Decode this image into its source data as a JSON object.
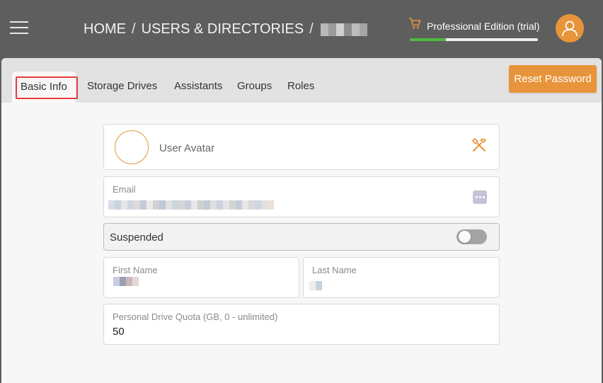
{
  "header": {
    "breadcrumb": [
      "HOME",
      "USERS & DIRECTORIES"
    ],
    "separator": "/",
    "current_user_pixels": [
      "#b9b9b9",
      "#9a9a9a",
      "#cfcfcf",
      "#8e8e8e",
      "#bcbcbc",
      "#a6a6a6"
    ],
    "edition_label": "Professional Edition (trial)",
    "trial_progress": 0.28,
    "cart_icon": "cart-icon",
    "account_icon": "user-icon"
  },
  "tabs": [
    {
      "label": "Basic Info",
      "active": true
    },
    {
      "label": "Storage Drives",
      "active": false
    },
    {
      "label": "Assistants",
      "active": false
    },
    {
      "label": "Groups",
      "active": false
    },
    {
      "label": "Roles",
      "active": false
    }
  ],
  "reset_password_label": "Reset Password",
  "form": {
    "avatar_label": "User Avatar",
    "avatar_icon": "tools-icon",
    "email_label": "Email",
    "email_pixels": [
      "#d8dde6",
      "#c9d3e1",
      "#e5e5e5",
      "#cfd7e3",
      "#dcdcdc",
      "#c4cbd8",
      "#eaeaea",
      "#d2d2d2",
      "#bfc8d6",
      "#e1e1e1",
      "#cdd5df",
      "#d6d6d6",
      "#c8cfda",
      "#e8e8e8",
      "#d0d0d0",
      "#c2cad6",
      "#dfdfdf",
      "#cbd3de",
      "#e3e3e3",
      "#d4d4d4",
      "#c6cdd9",
      "#e6e6e6",
      "#d9d9d9",
      "#cfd6e0",
      "#e0e0e0",
      "#eedfd5"
    ],
    "email_menu_icon": "more-dots-icon",
    "suspended_label": "Suspended",
    "suspended": false,
    "first_name_label": "First Name",
    "first_name_pixels": [
      "#c8cde0",
      "#9c9fb0",
      "#c9b8b8",
      "#e6d6d4"
    ],
    "last_name_label": "Last Name",
    "last_name_pixels": [
      "#eeeeee",
      "#c6d2e0"
    ],
    "quota_label": "Personal Drive Quota (GB, 0 - unlimited)",
    "quota_value": "50"
  },
  "colors": {
    "accent": "#e8943a",
    "highlight": "#e83c3c",
    "progress": "#4cbb3c",
    "header_bg": "#5e5e5e"
  }
}
